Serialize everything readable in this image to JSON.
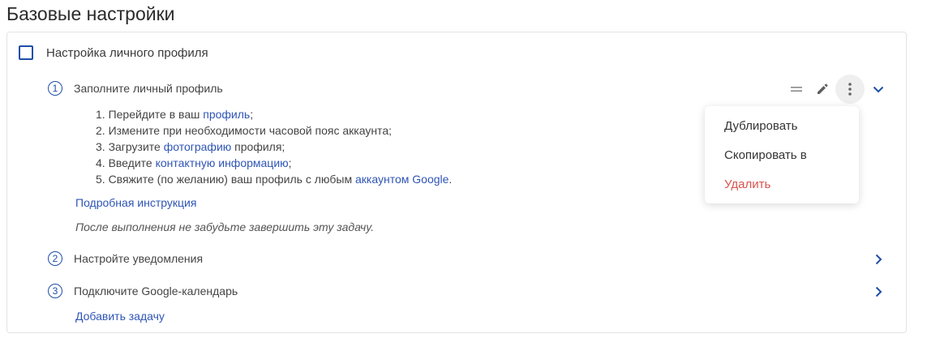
{
  "page": {
    "title": "Базовые настройки"
  },
  "section": {
    "title": "Настройка личного профиля",
    "checked": false
  },
  "tasks": [
    {
      "number": "1",
      "title": "Заполните личный профиль",
      "expanded": true
    },
    {
      "number": "2",
      "title": "Настройте уведомления",
      "expanded": false
    },
    {
      "number": "3",
      "title": "Подключите Google-календарь",
      "expanded": false
    }
  ],
  "steps": [
    {
      "prefix": "1. Перейдите в ваш ",
      "link": "профиль",
      "suffix": ";"
    },
    {
      "prefix": "2. Измените при необходимости часовой пояс аккаунта;",
      "link": "",
      "suffix": ""
    },
    {
      "prefix": "3. Загрузите ",
      "link": "фотографию",
      "suffix": " профиля;"
    },
    {
      "prefix": "4. Введите ",
      "link": "контактную информацию",
      "suffix": ";"
    },
    {
      "prefix": "5. Свяжите (по желанию) ваш профиль с любым ",
      "link": "аккаунтом Google",
      "suffix": "."
    }
  ],
  "detailed_link": "Подробная инструкция",
  "note": "После выполнения не забудьте завершить эту задачу.",
  "add_task": "Добавить задачу",
  "menu": {
    "items": [
      {
        "label": "Дублировать",
        "type": "normal"
      },
      {
        "label": "Скопировать в",
        "type": "normal"
      },
      {
        "label": "Удалить",
        "type": "danger"
      }
    ]
  },
  "icons": {
    "drag": "drag-handle-icon",
    "edit": "pencil-icon",
    "more": "kebab-icon",
    "collapse": "chevron-down-icon",
    "expand": "chevron-right-icon"
  },
  "colors": {
    "accent": "#1f4ea8",
    "link": "#2f55b5",
    "danger": "#d9534f"
  }
}
